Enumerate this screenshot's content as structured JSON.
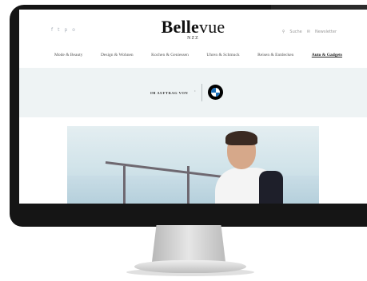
{
  "site": {
    "logo_bold": "Belle",
    "logo_light": "vue",
    "logo_sub": "NZZ",
    "social_icons": [
      "facebook-icon",
      "twitter-icon",
      "pinterest-icon",
      "instagram-icon"
    ],
    "social_glyphs": [
      "f",
      "t",
      "p",
      "o"
    ],
    "utility_search": "Suche",
    "utility_newsletter": "Newsletter"
  },
  "nav": {
    "items": [
      {
        "label": "Mode & Beauty"
      },
      {
        "label": "Design & Wohnen"
      },
      {
        "label": "Kochen & Geniessen"
      },
      {
        "label": "Uhren & Schmuck"
      },
      {
        "label": "Reisen & Entdecken"
      },
      {
        "label": "Auto & Gadgets"
      }
    ],
    "active_index": 5
  },
  "sponsor": {
    "label": "IM AUFTRAG VON",
    "arrow": "›",
    "brand_icon": "bmw-logo"
  },
  "colors": {
    "sponsor_bg": "#eef3f4",
    "bezel": "#151515",
    "bmw_blue": "#1d6fb8"
  }
}
